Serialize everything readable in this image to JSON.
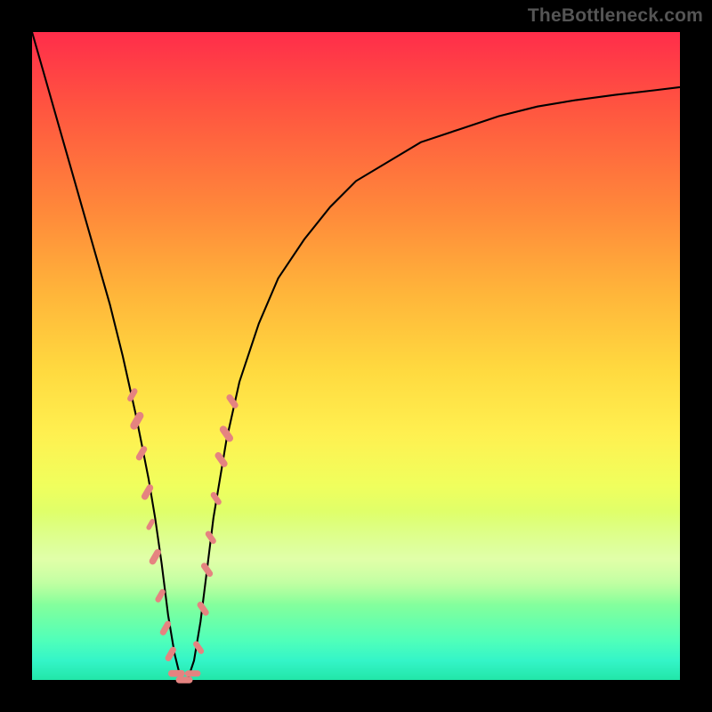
{
  "watermark": "TheBottleneck.com",
  "chart_data": {
    "type": "line",
    "title": "",
    "xlabel": "",
    "ylabel": "",
    "xlim": [
      0,
      100
    ],
    "ylim": [
      0,
      100
    ],
    "grid": false,
    "legend": false,
    "series": [
      {
        "name": "bottleneck-curve",
        "x": [
          0,
          2,
          4,
          6,
          8,
          10,
          12,
          14,
          16,
          17,
          18,
          19,
          20,
          21,
          22,
          23,
          24,
          25,
          26,
          27,
          28,
          30,
          32,
          35,
          38,
          42,
          46,
          50,
          55,
          60,
          66,
          72,
          78,
          84,
          90,
          96,
          100
        ],
        "values": [
          100,
          93,
          86,
          79,
          72,
          65,
          58,
          50,
          41,
          36,
          31,
          25,
          18,
          10,
          4,
          0,
          0,
          3,
          9,
          17,
          25,
          37,
          46,
          55,
          62,
          68,
          73,
          77,
          80,
          83,
          85,
          87,
          88.5,
          89.5,
          90.3,
          91,
          91.5
        ]
      }
    ],
    "markers": [
      {
        "x": 15.5,
        "y": 44,
        "size": 2.4
      },
      {
        "x": 16.2,
        "y": 40,
        "size": 3.2
      },
      {
        "x": 16.9,
        "y": 35,
        "size": 2.6
      },
      {
        "x": 17.8,
        "y": 29,
        "size": 2.8
      },
      {
        "x": 18.3,
        "y": 24,
        "size": 2.0
      },
      {
        "x": 19.0,
        "y": 19,
        "size": 2.8
      },
      {
        "x": 19.8,
        "y": 13,
        "size": 2.4
      },
      {
        "x": 20.6,
        "y": 8,
        "size": 2.6
      },
      {
        "x": 21.4,
        "y": 4,
        "size": 2.6
      },
      {
        "x": 22.3,
        "y": 1,
        "size": 2.8
      },
      {
        "x": 23.5,
        "y": 0,
        "size": 2.8
      },
      {
        "x": 24.8,
        "y": 1,
        "size": 2.6
      },
      {
        "x": 25.7,
        "y": 5,
        "size": 2.4
      },
      {
        "x": 26.4,
        "y": 11,
        "size": 2.6
      },
      {
        "x": 27.0,
        "y": 17,
        "size": 2.6
      },
      {
        "x": 27.6,
        "y": 22,
        "size": 2.4
      },
      {
        "x": 28.4,
        "y": 28,
        "size": 2.4
      },
      {
        "x": 29.2,
        "y": 34,
        "size": 2.8
      },
      {
        "x": 30.0,
        "y": 38,
        "size": 3.0
      },
      {
        "x": 30.9,
        "y": 43,
        "size": 2.6
      }
    ],
    "background_gradient": {
      "top": "#ff2d4a",
      "bottom": "#22e6a8"
    }
  }
}
